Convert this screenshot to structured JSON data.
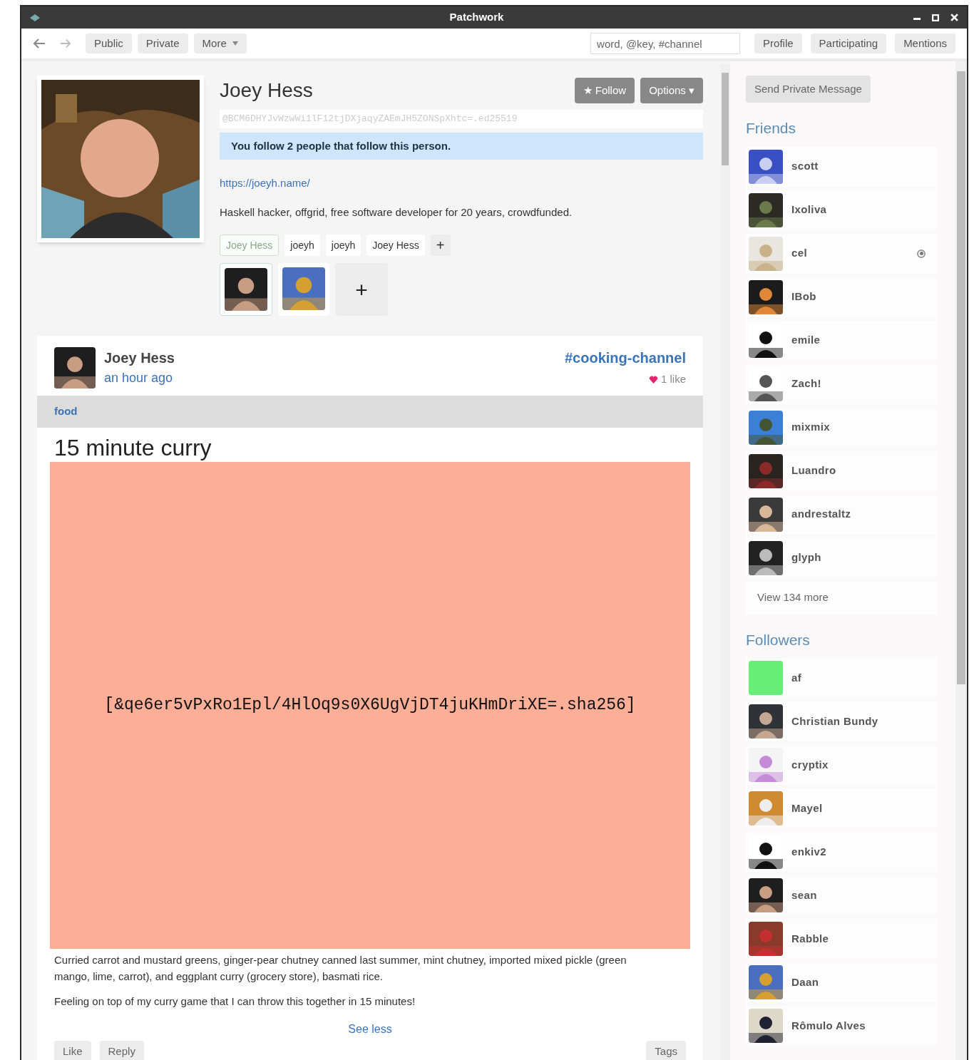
{
  "window": {
    "title": "Patchwork"
  },
  "toolbar": {
    "nav_buttons": [
      "Public",
      "Private",
      "More"
    ],
    "search": {
      "placeholder": "word, @key, #channel"
    },
    "right_buttons": [
      "Profile",
      "Participating",
      "Mentions"
    ]
  },
  "profile": {
    "name": "Joey Hess",
    "key": "@BCM6DHYJvWzwWi1lF12tjDXjaqyZAEmJH5ZONSpXhtc=.ed25519",
    "follow_button": "★ Follow",
    "options_button": "Options ▾",
    "notice": "You follow 2 people that follow this person.",
    "link": "https://joeyh.name/",
    "bio": "Haskell hacker, offgrid, free software developer for 20 years, crowdfunded.",
    "names": [
      {
        "label": "Joey Hess",
        "selected": true
      },
      {
        "label": "joeyh",
        "selected": false
      },
      {
        "label": "joeyh",
        "selected": false
      },
      {
        "label": "Joey Hess",
        "selected": false
      }
    ],
    "add_name": "+",
    "images": [
      {
        "selected": true
      },
      {
        "selected": false
      }
    ],
    "add_image": "+"
  },
  "post": {
    "author": "Joey Hess",
    "time": "an hour ago",
    "channel": "#cooking-channel",
    "likes": "1 like",
    "tag": "food",
    "title": "15 minute curry",
    "image_ref": "[&qe6er5vPxRo1Epl/4HlOq9s0X6UgVjDT4juKHmDriXE=.sha256]",
    "paragraphs": [
      "Curried carrot and mustard greens, ginger-pear chutney canned last summer, mint chutney, imported mixed pickle (green mango, lime, carrot), and eggplant curry (grocery store), basmati rice.",
      "Feeling on top of my curry game that I can throw this together in 15 minutes!"
    ],
    "see_less": "See less",
    "actions": [
      "Like",
      "Reply"
    ],
    "tags_button": "Tags"
  },
  "sidebar": {
    "message_button": "Send Private Message",
    "friends_title": "Friends",
    "friends": [
      {
        "name": "scott",
        "online": false
      },
      {
        "name": "Ixoliva",
        "online": false
      },
      {
        "name": "cel",
        "online": true
      },
      {
        "name": "IBob",
        "online": false
      },
      {
        "name": "emile",
        "online": false
      },
      {
        "name": "Zach!",
        "online": false
      },
      {
        "name": "mixmix",
        "online": false
      },
      {
        "name": "Luandro",
        "online": false
      },
      {
        "name": "andrestaltz",
        "online": false
      },
      {
        "name": "glyph",
        "online": false
      }
    ],
    "view_more": "View 134 more",
    "followers_title": "Followers",
    "followers": [
      {
        "name": "af",
        "online": false
      },
      {
        "name": "Christian Bundy",
        "online": false
      },
      {
        "name": "cryptix",
        "online": false
      },
      {
        "name": "Mayel",
        "online": false
      },
      {
        "name": "enkiv2",
        "online": false
      },
      {
        "name": "sean",
        "online": false
      },
      {
        "name": "Rabble",
        "online": false
      },
      {
        "name": "Daan",
        "online": false
      },
      {
        "name": "Rômulo Alves",
        "online": false
      }
    ]
  }
}
